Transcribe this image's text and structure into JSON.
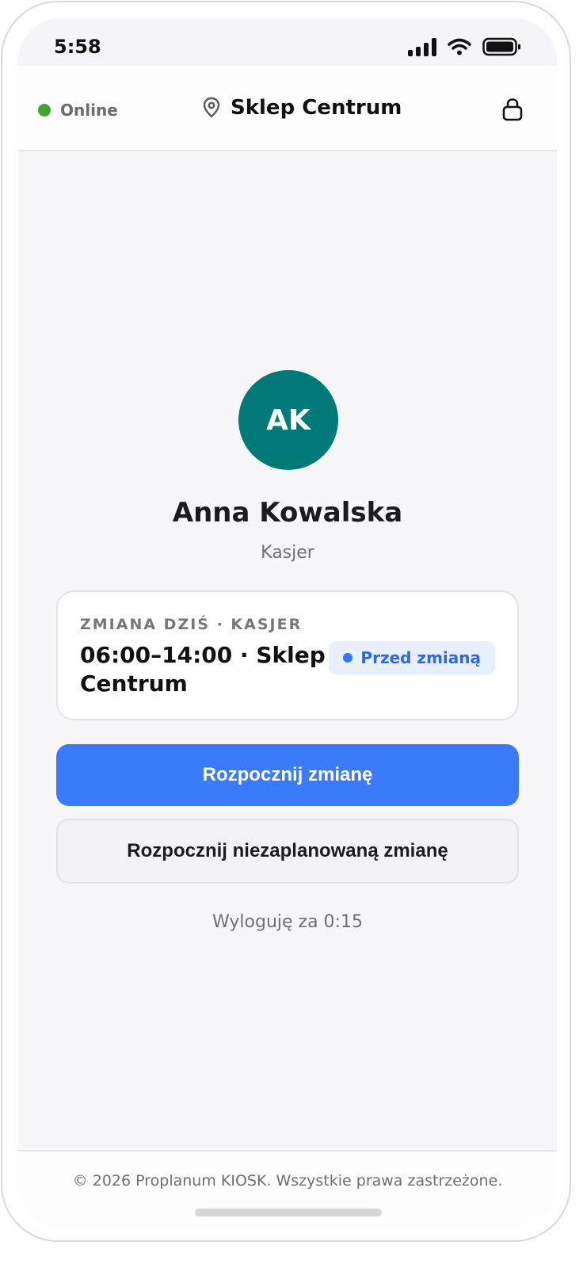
{
  "status_bar": {
    "time": "5:58"
  },
  "header": {
    "connection_status": "Online",
    "store_name": "Sklep Centrum"
  },
  "employee": {
    "initials": "AK",
    "name": "Anna Kowalska",
    "role": "Kasjer"
  },
  "shift_card": {
    "caption": "ZMIANA DZIŚ · KASJER",
    "time_location": "06:00–14:00 · Sklep Centrum",
    "status_badge": "Przed zmianą"
  },
  "actions": {
    "start_shift": "Rozpocznij zmianę",
    "start_unplanned_shift": "Rozpocznij niezaplanowaną zmianę"
  },
  "logout_timer": "Wyloguję za 0:15",
  "footer": {
    "copyright": "© 2026 Proplanum KIOSK. Wszystkie prawa zastrzeżone."
  },
  "colors": {
    "online": "#3aa832",
    "avatar": "#007a78",
    "primary": "#3b7bfa",
    "badge_bg": "#e8effd",
    "badge_text": "#2f69d8"
  },
  "icons": [
    "signal-icon",
    "wifi-icon",
    "battery-icon",
    "location-pin-icon",
    "lock-icon"
  ]
}
